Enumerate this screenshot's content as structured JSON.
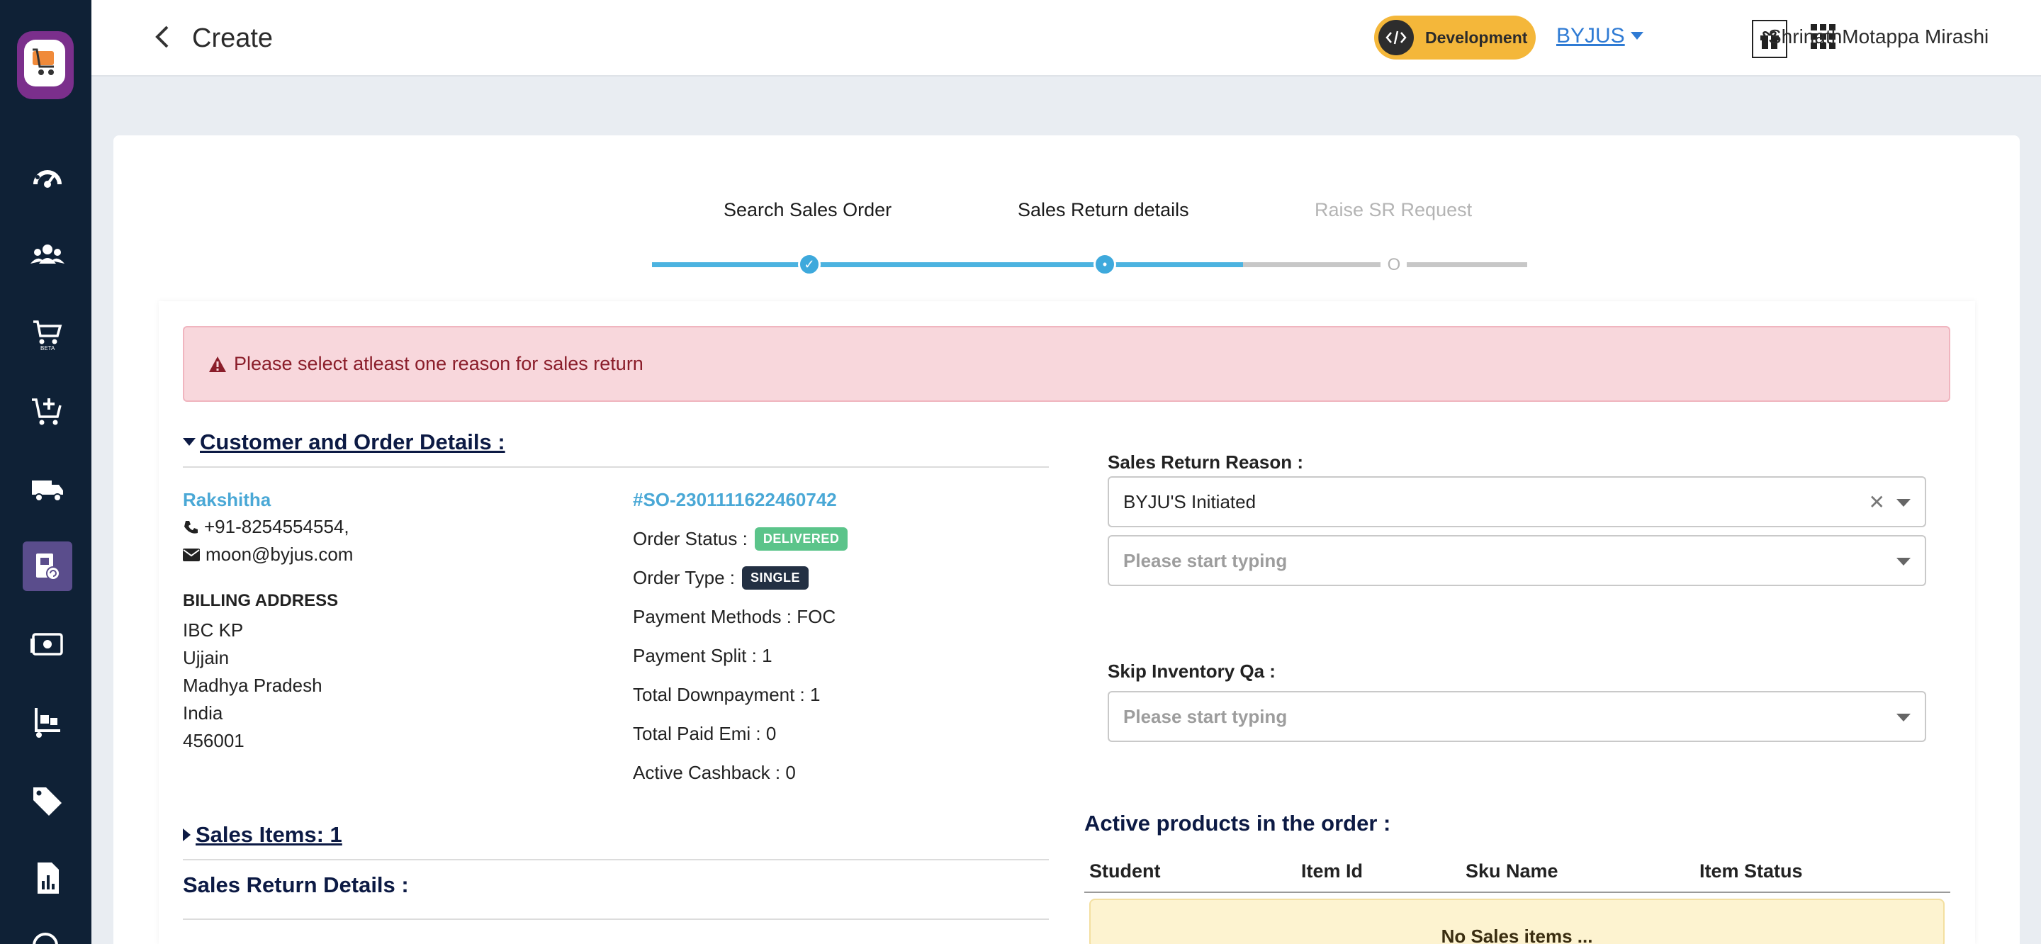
{
  "sidebar": {
    "items": [
      {
        "icon": "dashboard-icon"
      },
      {
        "icon": "users-icon"
      },
      {
        "icon": "beta-cart-icon"
      },
      {
        "icon": "add-cart-icon"
      },
      {
        "icon": "delivery-truck-icon"
      },
      {
        "icon": "sales-return-icon"
      },
      {
        "icon": "payment-icon"
      },
      {
        "icon": "inventory-icon"
      },
      {
        "icon": "tag-icon"
      },
      {
        "icon": "reports-icon"
      }
    ],
    "active_index": 5,
    "beta_label": "BETA"
  },
  "header": {
    "title": "Create",
    "env_badge": "Development",
    "org": "BYJUS",
    "user": "ShrinathMotappa Mirashi"
  },
  "stepper": {
    "steps": [
      {
        "label": "Search Sales Order",
        "state": "done"
      },
      {
        "label": "Sales Return details",
        "state": "active"
      },
      {
        "label": "Raise SR Request",
        "state": "pending"
      }
    ],
    "pending_marker": "O"
  },
  "alert": {
    "message": "Please select atleast one reason for sales return"
  },
  "customer_section": {
    "title": "Customer and Order Details :",
    "customer": {
      "name": "Rakshitha",
      "phone": "+91-8254554554,",
      "email": "moon@byjus.com"
    },
    "billing": {
      "heading": "BILLING ADDRESS",
      "lines": [
        "IBC KP",
        "Ujjain",
        "Madhya Pradesh",
        "India",
        "456001"
      ]
    },
    "order": {
      "number": "#SO-2301111622460742",
      "status_label": "Order Status :",
      "status_value": "DELIVERED",
      "type_label": "Order Type :",
      "type_value": "SINGLE",
      "payment_methods": "Payment Methods : FOC",
      "payment_split": "Payment Split : 1",
      "total_downpayment": "Total Downpayment : 1",
      "total_paid_emi": "Total Paid Emi : 0",
      "active_cashback": "Active Cashback : 0"
    }
  },
  "form": {
    "reason_label": "Sales Return Reason :",
    "reason_value": "BYJU'S Initiated",
    "reason_sub_placeholder": "Please start typing",
    "skip_qa_label": "Skip Inventory Qa :",
    "skip_qa_placeholder": "Please start typing"
  },
  "sales_items": {
    "title": "Sales Items: 1"
  },
  "sales_return_details": {
    "title": "Sales Return Details :"
  },
  "active_products": {
    "title": "Active products in the order :",
    "columns": [
      "Student",
      "Item Id",
      "Sku Name",
      "Item Status"
    ],
    "empty_text": "No Sales items ..."
  },
  "colors": {
    "sidebar_bg": "#0f2136",
    "accent": "#4cb3e0",
    "env_badge": "#f4b73a",
    "alert_bg": "#f8d7dc",
    "status_green": "#5bc48a"
  }
}
